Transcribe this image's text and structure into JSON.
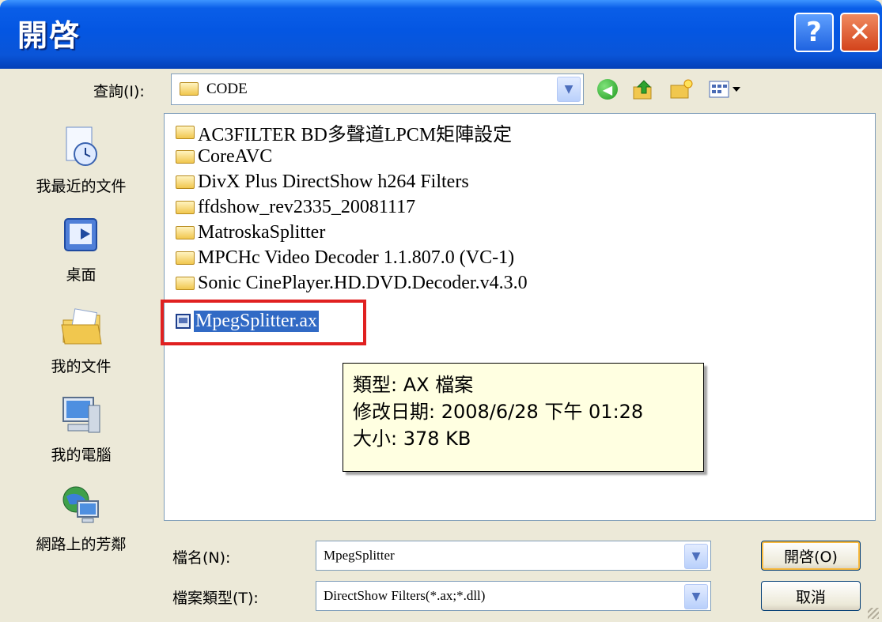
{
  "window": {
    "title": "開啓",
    "help_glyph": "?",
    "close_glyph": "✕"
  },
  "toolbar": {
    "lookin_label": "查詢(I):",
    "lookin_value": "CODE",
    "icons": [
      "back-icon",
      "up-folder-icon",
      "new-folder-icon",
      "views-menu-icon"
    ]
  },
  "places": [
    {
      "label": "我最近的文件",
      "icon": "recent-documents-icon"
    },
    {
      "label": "桌面",
      "icon": "desktop-icon"
    },
    {
      "label": "我的文件",
      "icon": "my-documents-icon"
    },
    {
      "label": "我的電腦",
      "icon": "my-computer-icon"
    },
    {
      "label": "網路上的芳鄰",
      "icon": "network-places-icon"
    }
  ],
  "files": [
    {
      "name": "AC3FILTER BD多聲道LPCM矩陣設定",
      "type": "folder"
    },
    {
      "name": "CoreAVC",
      "type": "folder"
    },
    {
      "name": "DivX Plus DirectShow h264 Filters",
      "type": "folder"
    },
    {
      "name": "ffdshow_rev2335_20081117",
      "type": "folder"
    },
    {
      "name": "MatroskaSplitter",
      "type": "folder"
    },
    {
      "name": "MPCHc Video Decoder 1.1.807.0 (VC-1)",
      "type": "folder"
    },
    {
      "name": "Sonic CinePlayer.HD.DVD.Decoder.v4.3.0",
      "type": "folder"
    },
    {
      "name": "MpegSplitter.ax",
      "type": "file",
      "selected": true
    }
  ],
  "tooltip": {
    "line1": "類型: AX 檔案",
    "line2": "修改日期: 2008/6/28 下午 01:28",
    "line3": "大小: 378 KB"
  },
  "form": {
    "filename_label": "檔名(N):",
    "filename_value": "MpegSplitter",
    "filetype_label": "檔案類型(T):",
    "filetype_value": "DirectShow Filters(*.ax;*.dll)",
    "open_button": "開啓(O)",
    "cancel_button": "取消"
  },
  "colors": {
    "titlebar": "#0456e2",
    "selection": "#316ac5",
    "highlight_box": "#e02020",
    "tooltip_bg": "#ffffe1"
  }
}
